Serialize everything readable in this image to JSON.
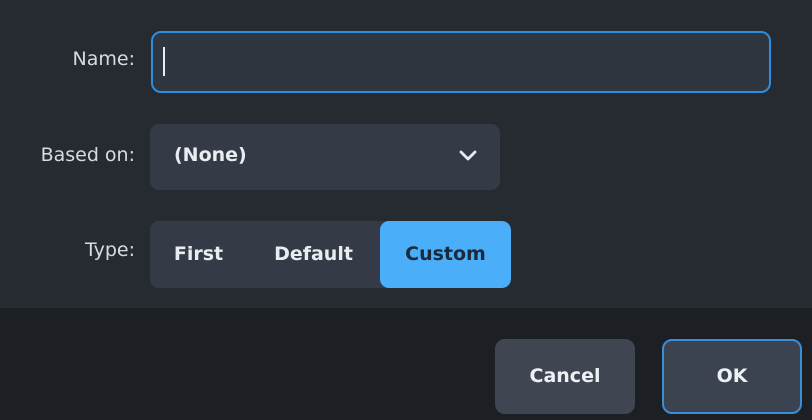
{
  "form": {
    "name_label": "Name:",
    "name_value": "",
    "based_on_label": "Based on:",
    "based_on_value": "(None)",
    "type_label": "Type:",
    "type_options": [
      "First",
      "Default",
      "Custom"
    ],
    "type_selected": "Custom"
  },
  "buttons": {
    "cancel": "Cancel",
    "ok": "OK"
  },
  "colors": {
    "accent": "#4aaef9",
    "focus_border": "#2a8fe0",
    "background": "#262a31",
    "footer": "#1c1f24"
  },
  "icons": {
    "dropdown": "chevron-down-icon"
  }
}
